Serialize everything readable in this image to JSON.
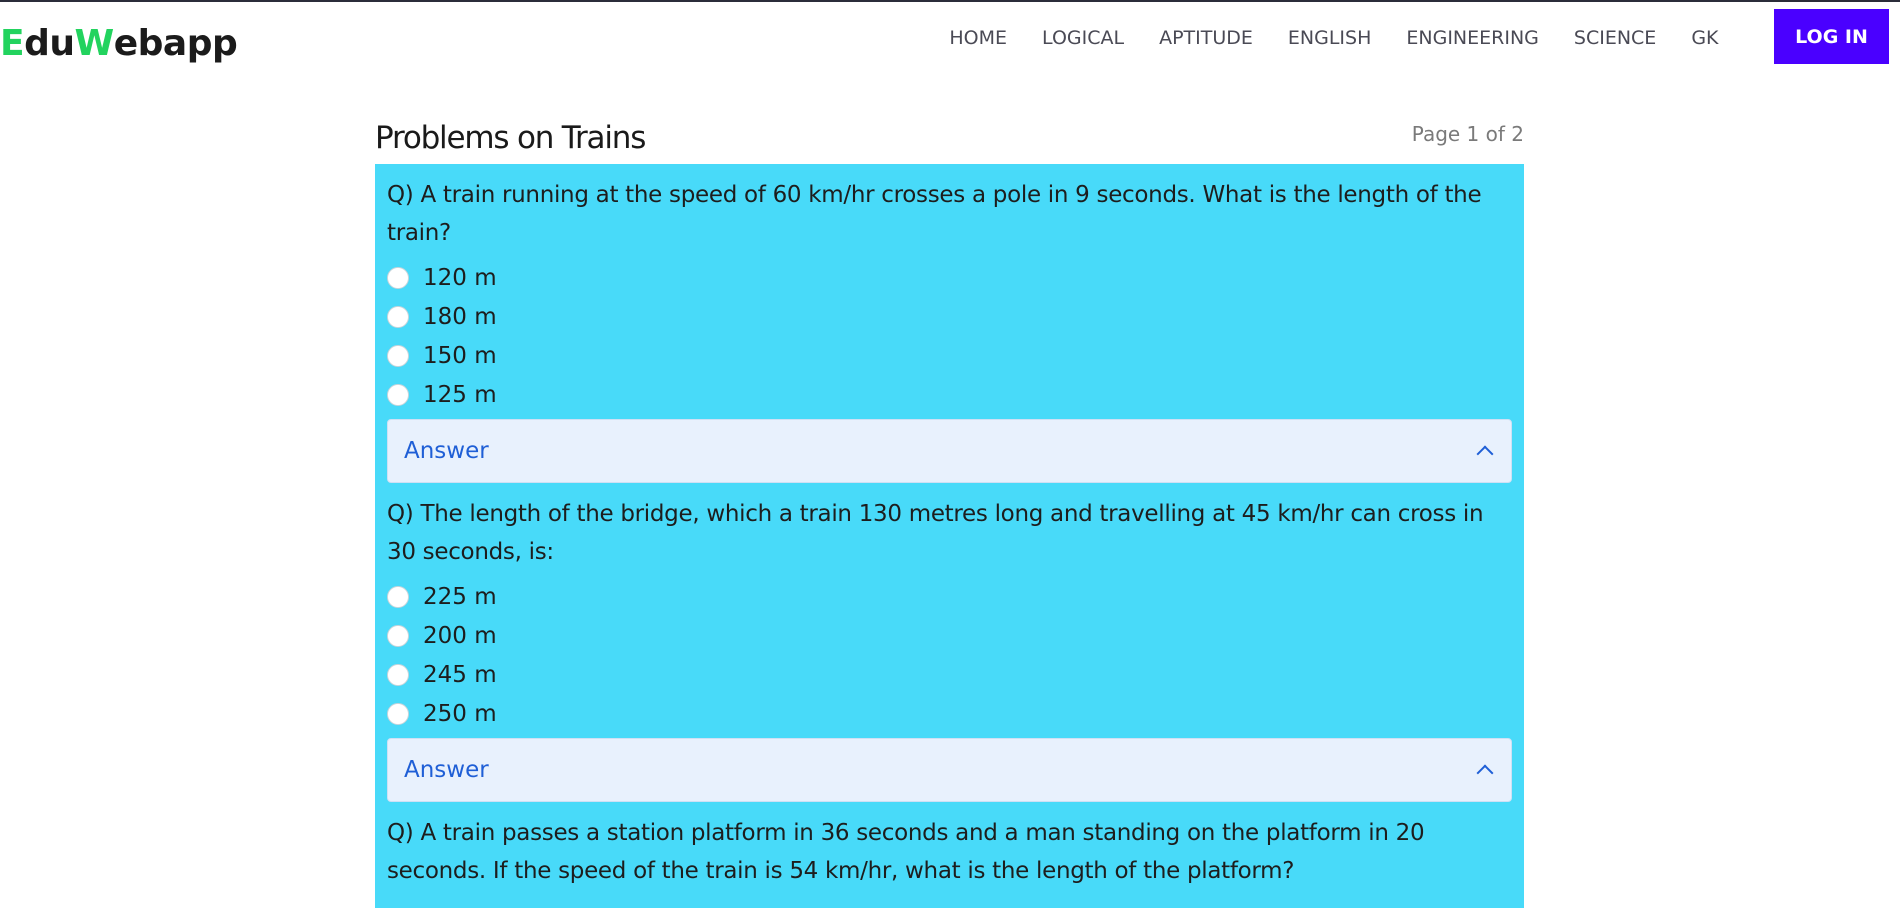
{
  "brand": {
    "parts": [
      {
        "text": "E",
        "color": "green"
      },
      {
        "text": "du",
        "color": "dark"
      },
      {
        "text": "W",
        "color": "green"
      },
      {
        "text": "ebapp",
        "color": "dark"
      }
    ]
  },
  "nav": {
    "links": [
      "HOME",
      "LOGICAL",
      "APTITUDE",
      "ENGLISH",
      "ENGINEERING",
      "SCIENCE",
      "GK"
    ],
    "login_label": "LOG IN"
  },
  "page": {
    "title": "Problems on Trains",
    "indicator": "Page 1 of 2"
  },
  "questions": [
    {
      "text": "Q) A train running at the speed of 60 km/hr crosses a pole in 9 seconds. What is the length of the train?",
      "options": [
        "120 m",
        "180 m",
        "150 m",
        "125 m"
      ],
      "answer_label": "Answer"
    },
    {
      "text": "Q) The length of the bridge, which a train 130 metres long and travelling at 45 km/hr can cross in 30 seconds, is:",
      "options": [
        "225 m",
        "200 m",
        "245 m",
        "250 m"
      ],
      "answer_label": "Answer"
    },
    {
      "text": "Q) A train passes a station platform in 36 seconds and a man standing on the platform in 20 seconds. If the speed of the train is 54 km/hr, what is the length of the platform?",
      "options": [],
      "answer_label": ""
    }
  ],
  "colors": {
    "brand_green": "#22d35e",
    "accent": "#4a00ff",
    "panel": "#48daf9",
    "answer_bg": "#e8f1fd",
    "answer_text": "#1f5fd6"
  }
}
